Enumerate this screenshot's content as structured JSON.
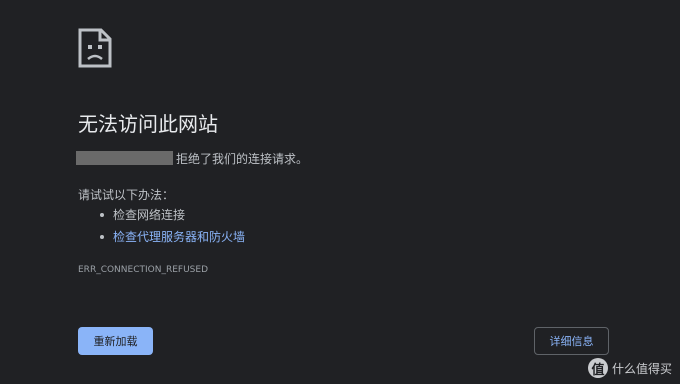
{
  "error_page": {
    "title": "无法访问此网站",
    "message": "拒绝了我们的连接请求。",
    "suggestions_heading": "请试试以下办法：",
    "suggestions": [
      {
        "label": "检查网络连接"
      },
      {
        "label": "检查代理服务器和防火墙"
      }
    ],
    "error_code": "ERR_CONNECTION_REFUSED",
    "reload_label": "重新加载",
    "details_label": "详细信息",
    "icon": "sad-page-icon"
  },
  "watermark": {
    "badge_glyph": "值",
    "text": "什么值得买"
  },
  "colors": {
    "background": "#202124",
    "text": "#bdc1c6",
    "title": "#e8eaed",
    "link": "#8ab4f8",
    "redaction": "#6a6a6a"
  }
}
